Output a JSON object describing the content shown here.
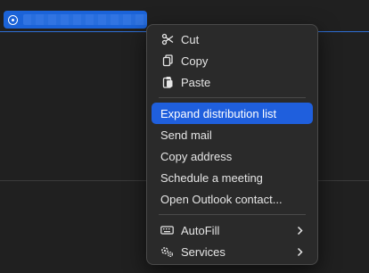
{
  "menu": {
    "group1": [
      {
        "label": "Cut",
        "icon": "scissors-icon"
      },
      {
        "label": "Copy",
        "icon": "copy-icon"
      },
      {
        "label": "Paste",
        "icon": "paste-icon"
      }
    ],
    "group2": [
      {
        "label": "Expand distribution list",
        "highlighted": true
      },
      {
        "label": "Send mail"
      },
      {
        "label": "Copy address"
      },
      {
        "label": "Schedule a meeting"
      },
      {
        "label": "Open Outlook contact..."
      }
    ],
    "group3": [
      {
        "label": "AutoFill",
        "icon": "keyboard-icon",
        "submenu": true
      },
      {
        "label": "Services",
        "icon": "gear-icon",
        "submenu": true
      }
    ]
  },
  "colors": {
    "accent": "#1f5fdd",
    "chip": "#1b63d8",
    "menu_bg": "#2a2a2a",
    "window_bg": "#202020"
  }
}
